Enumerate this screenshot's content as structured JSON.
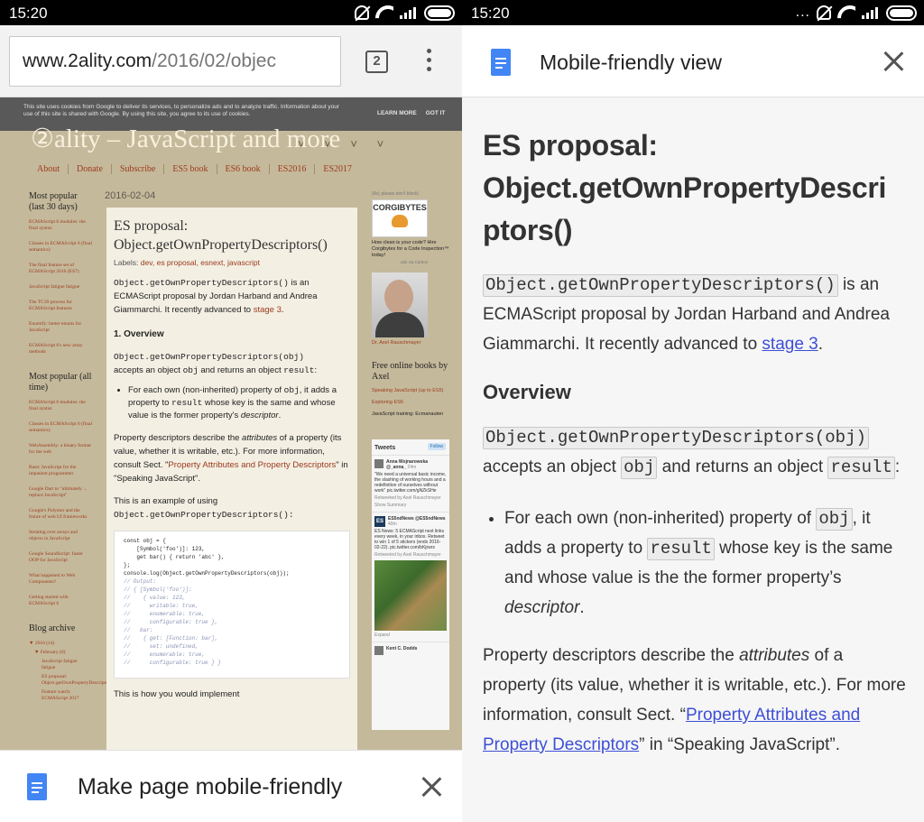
{
  "status": {
    "time": "15:20",
    "overflow": "..."
  },
  "browser": {
    "url_host": "www.2ality.com",
    "url_path": "/2016/02/objec",
    "tab_count": "2"
  },
  "site": {
    "cookie_text": "This site uses cookies from Google to deliver its services, to personalize ads and to analyze traffic. Information about your use of this site is shared with Google. By using this site, you agree to its use of cookies.",
    "learn_more": "LEARN MORE",
    "got_it": "GOT IT",
    "title": "②ality – JavaScript and more",
    "nav": [
      "About",
      "Donate",
      "Subscribe",
      "ES5 book",
      "ES6 book",
      "ES2016",
      "ES2017"
    ],
    "popular30_title": "Most popular (last 30 days)",
    "popular30": [
      "ECMAScript 6 modules: the final syntax",
      "Classes in ECMAScript 6 (final semantics)",
      "The final feature set of ECMAScript 2016 (ES7)",
      "JavaScript fatigue fatigue",
      "The TC39 process for ECMAScript features",
      "Enumify: better enums for JavaScript",
      "ECMAScript 6's new array methods"
    ],
    "popularAll_title": "Most popular (all time)",
    "popularAll": [
      "ECMAScript 6 modules: the final syntax",
      "Classes in ECMAScript 6 (final semantics)",
      "WebAssembly: a binary format for the web",
      "Basic JavaScript for the impatient programmer",
      "Google Dart to \"ultimately ... replace JavaScript\"",
      "Google's Polymer and the future of web UI frameworks",
      "Iterating over arrays and objects in JavaScript",
      "Google SoundScript: faster OOP for JavaScript",
      "What happened to Web Components?",
      "Getting started with ECMAScript 6"
    ],
    "archive_title": "Blog archive",
    "archive": [
      "▼ 2016 (14)",
      "▼ February (6)",
      "JavaScript fatigue fatigue",
      "ES proposal: Object.getOwnPropertyDescriptors()",
      "Feature watch: ECMAScript 2017"
    ],
    "post_date": "2016-02-04",
    "post_title": "ES proposal: Object.getOwnPropertyDescriptors()",
    "labels_prefix": "Labels:",
    "labels": "dev, es proposal, esnext, javascript",
    "intro_code": "Object.getOwnPropertyDescriptors()",
    "intro_text": " is an ECMAScript proposal by Jordan Harband and Andrea Giammarchi. It recently advanced to ",
    "intro_link": "stage 3",
    "overview": "1.  Overview",
    "ov_code": "Object.getOwnPropertyDescriptors(obj)",
    "ov_text1": "accepts an object ",
    "ov_obj": "obj",
    "ov_text2": " and returns an object ",
    "ov_result": "result",
    "bullet_a": "For each own (non-inherited) property of ",
    "bullet_obj": "obj",
    "bullet_b": ", it adds a property to ",
    "bullet_result": "result",
    "bullet_c": " whose key is the same and whose value is the former property's ",
    "bullet_desc": "descriptor",
    "pd_a": "Property descriptors describe the ",
    "pd_attr": "attributes",
    "pd_b": " of a property (its value, whether it is writable, etc.). For more information, consult Sect. \"",
    "pd_link": "Property Attributes and Property Descriptors",
    "pd_c": "\" in \"Speaking JavaScript\".",
    "ex_text": "This is an example of using",
    "ex_code": "Object.getOwnPropertyDescriptors():",
    "code_lines": [
      "const obj = {",
      "    [Symbol('foo')]: 123,",
      "    get bar() { return 'abc' },",
      "};",
      "console.log(Object.getOwnPropertyDescriptors(obj));",
      "",
      "// Output:",
      "// { [Symbol('foo')]:",
      "//    { value: 123,",
      "//      writable: true,",
      "//      enumerable: true,",
      "//      configurable: true },",
      "//   bar:",
      "//    { get: [Function: bar],",
      "//      set: undefined,",
      "//      enumerable: true,",
      "//      configurable: true } }"
    ],
    "after_code": "This is how you would implement",
    "ad_label": "(Ad, please don't block)",
    "corgi": "CORGIBYTES",
    "corgi_text": "How clean is your code? Hire Corgibytes for a Code Inspection™ today!",
    "ads_via": "ads via Carbon",
    "author_caption": "Dr. Axel Rauschmayer",
    "books_title": "Free online books by Axel",
    "books": [
      "Speaking JavaScript (up to ES5)",
      "Exploring ES6",
      "JavaScript training: Ecmanauten"
    ],
    "tweets_title": "Tweets",
    "follow": "Follow",
    "tweet1_author": "Anna Wojnarowska @_anna_",
    "tweet1_time": "24m",
    "tweet1_text": "\"We need a universal basic income, the slashing of working hours and a redefinition of ourselves without work\" pic.twitter.com/gNZkSHe",
    "tweet1_rt": "Retweeted by Axel Rauschmayer",
    "tweet1_show": "Show Summary",
    "tweet2_author": "ES5ndNews @ES5ndNews",
    "tweet2_time": "40m",
    "tweet2_text": "ES News: 5 ECMAScript next links every week, in your inbox. Retweet to win 1 of 5 stickers (ends 2016-02-22). pic.twitter.com/bKjrwrs",
    "tweet2_rt": "Retweeted by Axel Rauschmayer",
    "expand": "Expand",
    "tweet3_author": "Kent C. Dodds"
  },
  "bottom_prompt": {
    "label": "Make page mobile-friendly"
  },
  "mobile": {
    "header_title": "Mobile-friendly view",
    "title": "ES proposal: Object.getOwnPropertyDescriptors()",
    "intro_code": "Object.getOwnPropertyDescriptors()",
    "intro_text": " is an ECMAScript proposal by Jordan Harband and Andrea Giammarchi. It recently advanced to ",
    "intro_link": "stage 3",
    "intro_end": ".",
    "overview": "Overview",
    "ov_code": "Object.getOwnPropertyDescriptors(obj)",
    "ov_text1": " accepts an object ",
    "ov_obj": "obj",
    "ov_text2": " and returns an object ",
    "ov_result": "result",
    "ov_end": ":",
    "bullet_a": "For each own (non-inherited) property of ",
    "bullet_obj": "obj",
    "bullet_b": ", it adds a property to ",
    "bullet_result": "result",
    "bullet_c": " whose key is the same and whose value is the the former property’s ",
    "bullet_desc": "descriptor",
    "bullet_end": ".",
    "pd_a": "Property descriptors describe the ",
    "pd_attr": "attributes",
    "pd_b": " of a property (its value, whether it is writable, etc.). For more information, consult Sect. “",
    "pd_link": "Property Attributes and Property Descriptors",
    "pd_c": "” in “Speaking JavaScript”."
  }
}
